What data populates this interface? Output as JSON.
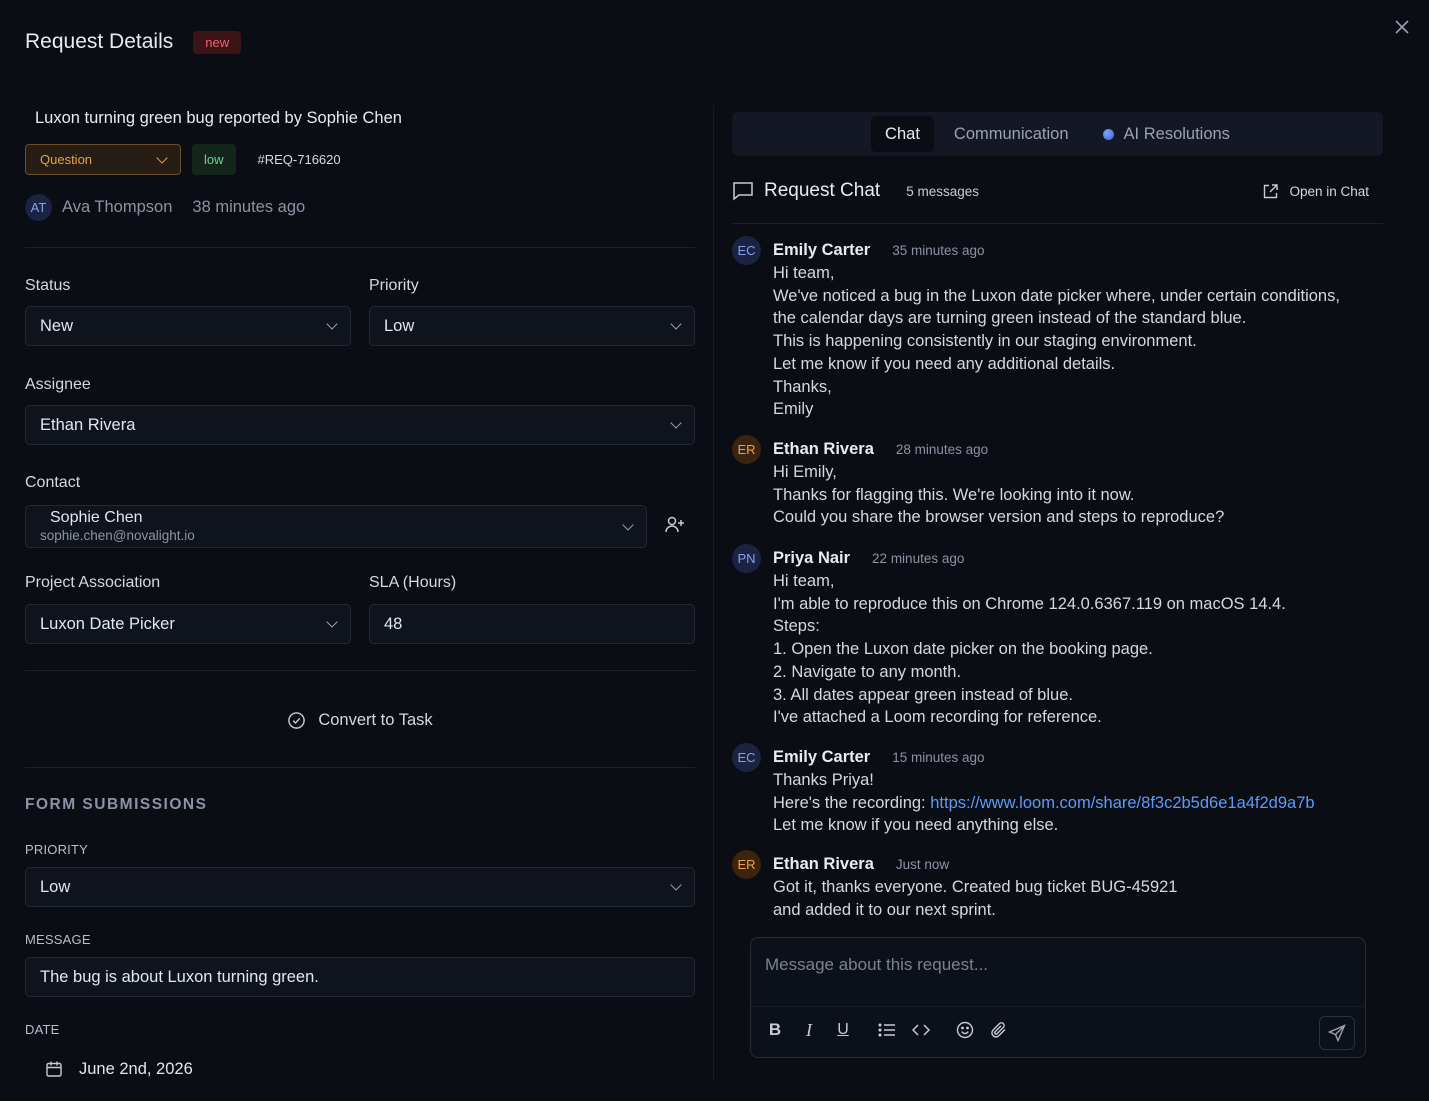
{
  "header": {
    "title": "Request Details",
    "status_badge": "new"
  },
  "request": {
    "title": "Luxon turning green bug reported by Sophie Chen",
    "type": "Question",
    "priority_chip": "low",
    "id": "#REQ-716620",
    "author_initials": "AT",
    "author": "Ava Thompson",
    "created": "38 minutes ago"
  },
  "fields": {
    "status_label": "Status",
    "status_value": "New",
    "priority_label": "Priority",
    "priority_value": "Low",
    "assignee_label": "Assignee",
    "assignee_value": "Ethan Rivera",
    "contact_label": "Contact",
    "contact_name": "Sophie Chen",
    "contact_email": "sophie.chen@novalight.io",
    "project_label": "Project Association",
    "project_value": "Luxon Date Picker",
    "sla_label": "SLA (Hours)",
    "sla_value": "48"
  },
  "convert_label": "Convert to Task",
  "form": {
    "section_label": "FORM SUBMISSIONS",
    "priority_label": "PRIORITY",
    "priority_value": "Low",
    "message_label": "MESSAGE",
    "message_value": "The bug is about Luxon turning green.",
    "date_label": "DATE",
    "date_value": "June 2nd, 2026"
  },
  "tabs": [
    "Chat",
    "Communication",
    "AI Resolutions"
  ],
  "chat": {
    "title": "Request Chat",
    "count": "5 messages",
    "open_label": "Open in Chat",
    "messages": [
      {
        "initials": "EC",
        "name": "Emily Carter",
        "time": "35 minutes ago",
        "lines": [
          "Hi team,",
          "We've noticed a bug in the Luxon date picker where, under certain conditions,",
          "the calendar days are turning green instead of the standard blue.",
          "This is happening consistently in our staging environment.",
          "Let me know if you need any additional details.",
          "Thanks,",
          "Emily"
        ]
      },
      {
        "initials": "ER",
        "name": "Ethan Rivera",
        "time": "28 minutes ago",
        "lines": [
          "Hi Emily,",
          "Thanks for flagging this. We're looking into it now.",
          "Could you share the browser version and steps to reproduce?"
        ]
      },
      {
        "initials": "PN",
        "name": "Priya Nair",
        "time": "22 minutes ago",
        "lines": [
          "Hi team,",
          "I'm able to reproduce this on Chrome 124.0.6367.119 on macOS 14.4.",
          "Steps:",
          "1.  Open the Luxon date picker on the booking page.",
          "2.  Navigate to any month.",
          "3.  All dates appear green instead of blue.",
          "I've attached a Loom recording for reference."
        ]
      },
      {
        "initials": "EC",
        "name": "Emily Carter",
        "time": "15 minutes ago",
        "lines": [
          "Thanks Priya!",
          "Here's the recording: ",
          "Let me know if you need anything else."
        ],
        "link": "https://www.loom.com/share/8f3c2b5d6e1a4f2d9a7b"
      },
      {
        "initials": "ER",
        "name": "Ethan Rivera",
        "time": "Just now",
        "lines": [
          "Got it, thanks everyone. Created bug ticket BUG-45921",
          "and added it to our next sprint."
        ]
      }
    ]
  },
  "composer": {
    "placeholder": "Message about this request..."
  },
  "colors": {
    "accent_new": "#f0646f",
    "question": "#e8a24b",
    "low": "#6cd199",
    "link": "#5f9bf5"
  }
}
